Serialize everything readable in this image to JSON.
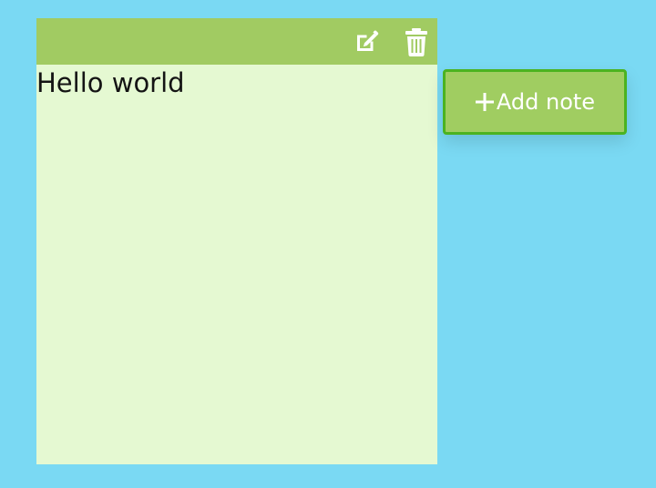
{
  "note": {
    "content": "Hello world",
    "toolbar": {
      "edit_icon": "edit-icon",
      "delete_icon": "trash-icon"
    }
  },
  "add_note": {
    "label": "Add note",
    "icon": "plus-icon"
  },
  "colors": {
    "page_background": "#7ad9f3",
    "note_background": "#e5f9d2",
    "note_toolbar": "#a1cb62",
    "button_background": "#a0cd61",
    "button_border": "#4bb320",
    "icon_color": "#ffffff"
  }
}
